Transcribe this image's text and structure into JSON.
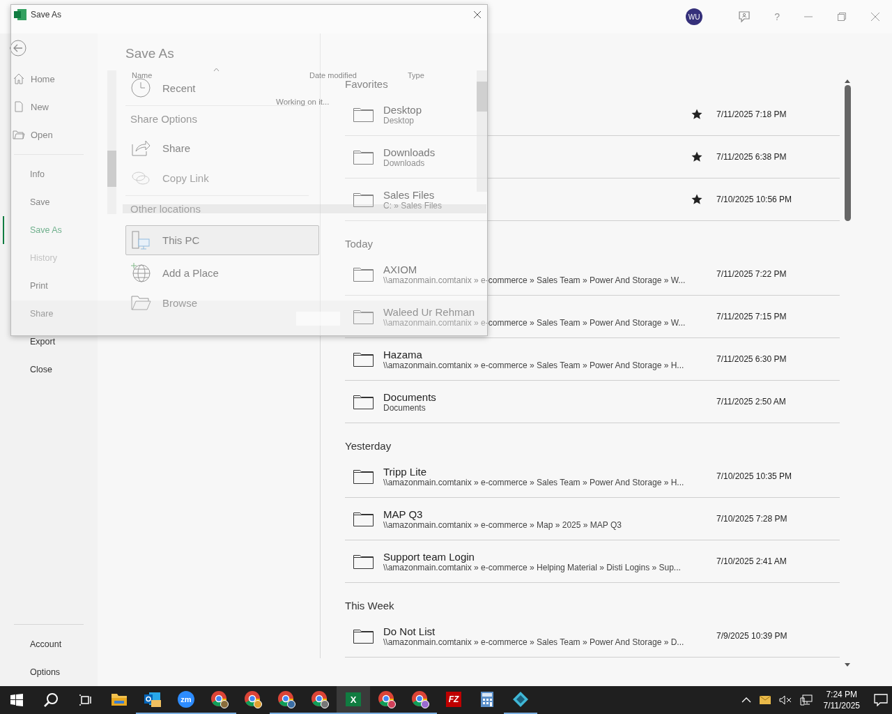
{
  "window": {
    "account_initials": "WU",
    "help": "?"
  },
  "dialog": {
    "title": "Save As",
    "columns": [
      "Name",
      "Date modified",
      "Type"
    ],
    "status": "Working on it..."
  },
  "nav": {
    "top": [
      "Home",
      "New",
      "Open"
    ],
    "items": [
      {
        "label": "Info",
        "selected": false,
        "disabled": false
      },
      {
        "label": "Save",
        "selected": false,
        "disabled": false
      },
      {
        "label": "Save As",
        "selected": true,
        "disabled": false
      },
      {
        "label": "History",
        "selected": false,
        "disabled": true
      },
      {
        "label": "Print",
        "selected": false,
        "disabled": false
      },
      {
        "label": "Share",
        "selected": false,
        "disabled": false
      },
      {
        "label": "Export",
        "selected": false,
        "disabled": false
      },
      {
        "label": "Close",
        "selected": false,
        "disabled": false
      }
    ],
    "bottom": [
      "Account",
      "Options"
    ]
  },
  "places": {
    "title": "Save As",
    "items": [
      {
        "kind": "item",
        "label": "Recent",
        "selected": false,
        "disabled": false
      },
      {
        "kind": "header",
        "label": "Share Options"
      },
      {
        "kind": "item",
        "label": "Share",
        "selected": false,
        "disabled": false
      },
      {
        "kind": "item",
        "label": "Copy Link",
        "selected": false,
        "disabled": true
      },
      {
        "kind": "header",
        "label": "Other locations"
      },
      {
        "kind": "item",
        "label": "This PC",
        "selected": true,
        "disabled": false
      },
      {
        "kind": "item",
        "label": "Add a Place",
        "selected": false,
        "disabled": false
      },
      {
        "kind": "item",
        "label": "Browse",
        "selected": false,
        "disabled": false
      }
    ]
  },
  "recent": {
    "groups": [
      {
        "title": "Favorites",
        "rows": [
          {
            "name": "Desktop",
            "path": "Desktop",
            "pinned": true,
            "date": "7/11/2025 7:18 PM"
          },
          {
            "name": "Downloads",
            "path": "Downloads",
            "pinned": true,
            "date": "7/11/2025 6:38 PM"
          },
          {
            "name": "Sales Files",
            "path": "C: » Sales Files",
            "pinned": true,
            "date": "7/10/2025 10:56 PM"
          }
        ]
      },
      {
        "title": "Today",
        "rows": [
          {
            "name": "AXIOM",
            "path": "\\\\amazonmain.comtanix » e-commerce » Sales Team » Power And Storage » W...",
            "pinned": false,
            "date": "7/11/2025 7:22 PM"
          },
          {
            "name": "Waleed Ur Rehman",
            "path": "\\\\amazonmain.comtanix » e-commerce » Sales Team » Power And Storage » W...",
            "pinned": false,
            "date": "7/11/2025 7:15 PM"
          },
          {
            "name": "Hazama",
            "path": "\\\\amazonmain.comtanix » e-commerce » Sales Team » Power And Storage » H...",
            "pinned": false,
            "date": "7/11/2025 6:30 PM"
          },
          {
            "name": "Documents",
            "path": "Documents",
            "pinned": false,
            "date": "7/11/2025 2:50 AM"
          }
        ]
      },
      {
        "title": "Yesterday",
        "rows": [
          {
            "name": "Tripp Lite",
            "path": "\\\\amazonmain.comtanix » e-commerce » Sales Team » Power And Storage » H...",
            "pinned": false,
            "date": "7/10/2025 10:35 PM"
          },
          {
            "name": "MAP Q3",
            "path": "\\\\amazonmain.comtanix » e-commerce » Map » 2025 » MAP Q3",
            "pinned": false,
            "date": "7/10/2025 7:28 PM"
          },
          {
            "name": "Support team Login",
            "path": "\\\\amazonmain.comtanix » e-commerce » Helping Material » Disti Logins » Sup...",
            "pinned": false,
            "date": "7/10/2025 2:41 AM"
          }
        ]
      },
      {
        "title": "This Week",
        "rows": [
          {
            "name": "Do Not List",
            "path": "\\\\amazonmain.comtanix » e-commerce » Sales Team » Power And Storage » D...",
            "pinned": false,
            "date": "7/9/2025 10:39 PM"
          }
        ]
      }
    ]
  },
  "taskbar": {
    "apps": [
      {
        "kind": "explorer",
        "running": false,
        "active": false
      },
      {
        "kind": "outlook",
        "running": true,
        "active": false
      },
      {
        "kind": "zoom",
        "label": "zm",
        "running": true,
        "active": false
      },
      {
        "kind": "chrome",
        "color": "#8a6d3b",
        "running": true,
        "active": false
      },
      {
        "kind": "chrome",
        "color": "#e0a030",
        "running": false,
        "active": false
      },
      {
        "kind": "chrome",
        "color": "#3a6ea5",
        "running": true,
        "active": false
      },
      {
        "kind": "chrome",
        "color": "#777777",
        "running": true,
        "active": false
      },
      {
        "kind": "excel",
        "label": "X",
        "running": true,
        "active": true
      },
      {
        "kind": "chrome",
        "color": "#d0405a",
        "running": true,
        "active": false
      },
      {
        "kind": "chrome",
        "color": "#9a6ad0",
        "running": true,
        "active": false
      },
      {
        "kind": "filezilla",
        "label": "FZ",
        "running": false,
        "active": false
      },
      {
        "kind": "calculator",
        "running": false,
        "active": false
      },
      {
        "kind": "diamond",
        "running": true,
        "active": false
      }
    ],
    "time": "7:24 PM",
    "date": "7/11/2025"
  }
}
